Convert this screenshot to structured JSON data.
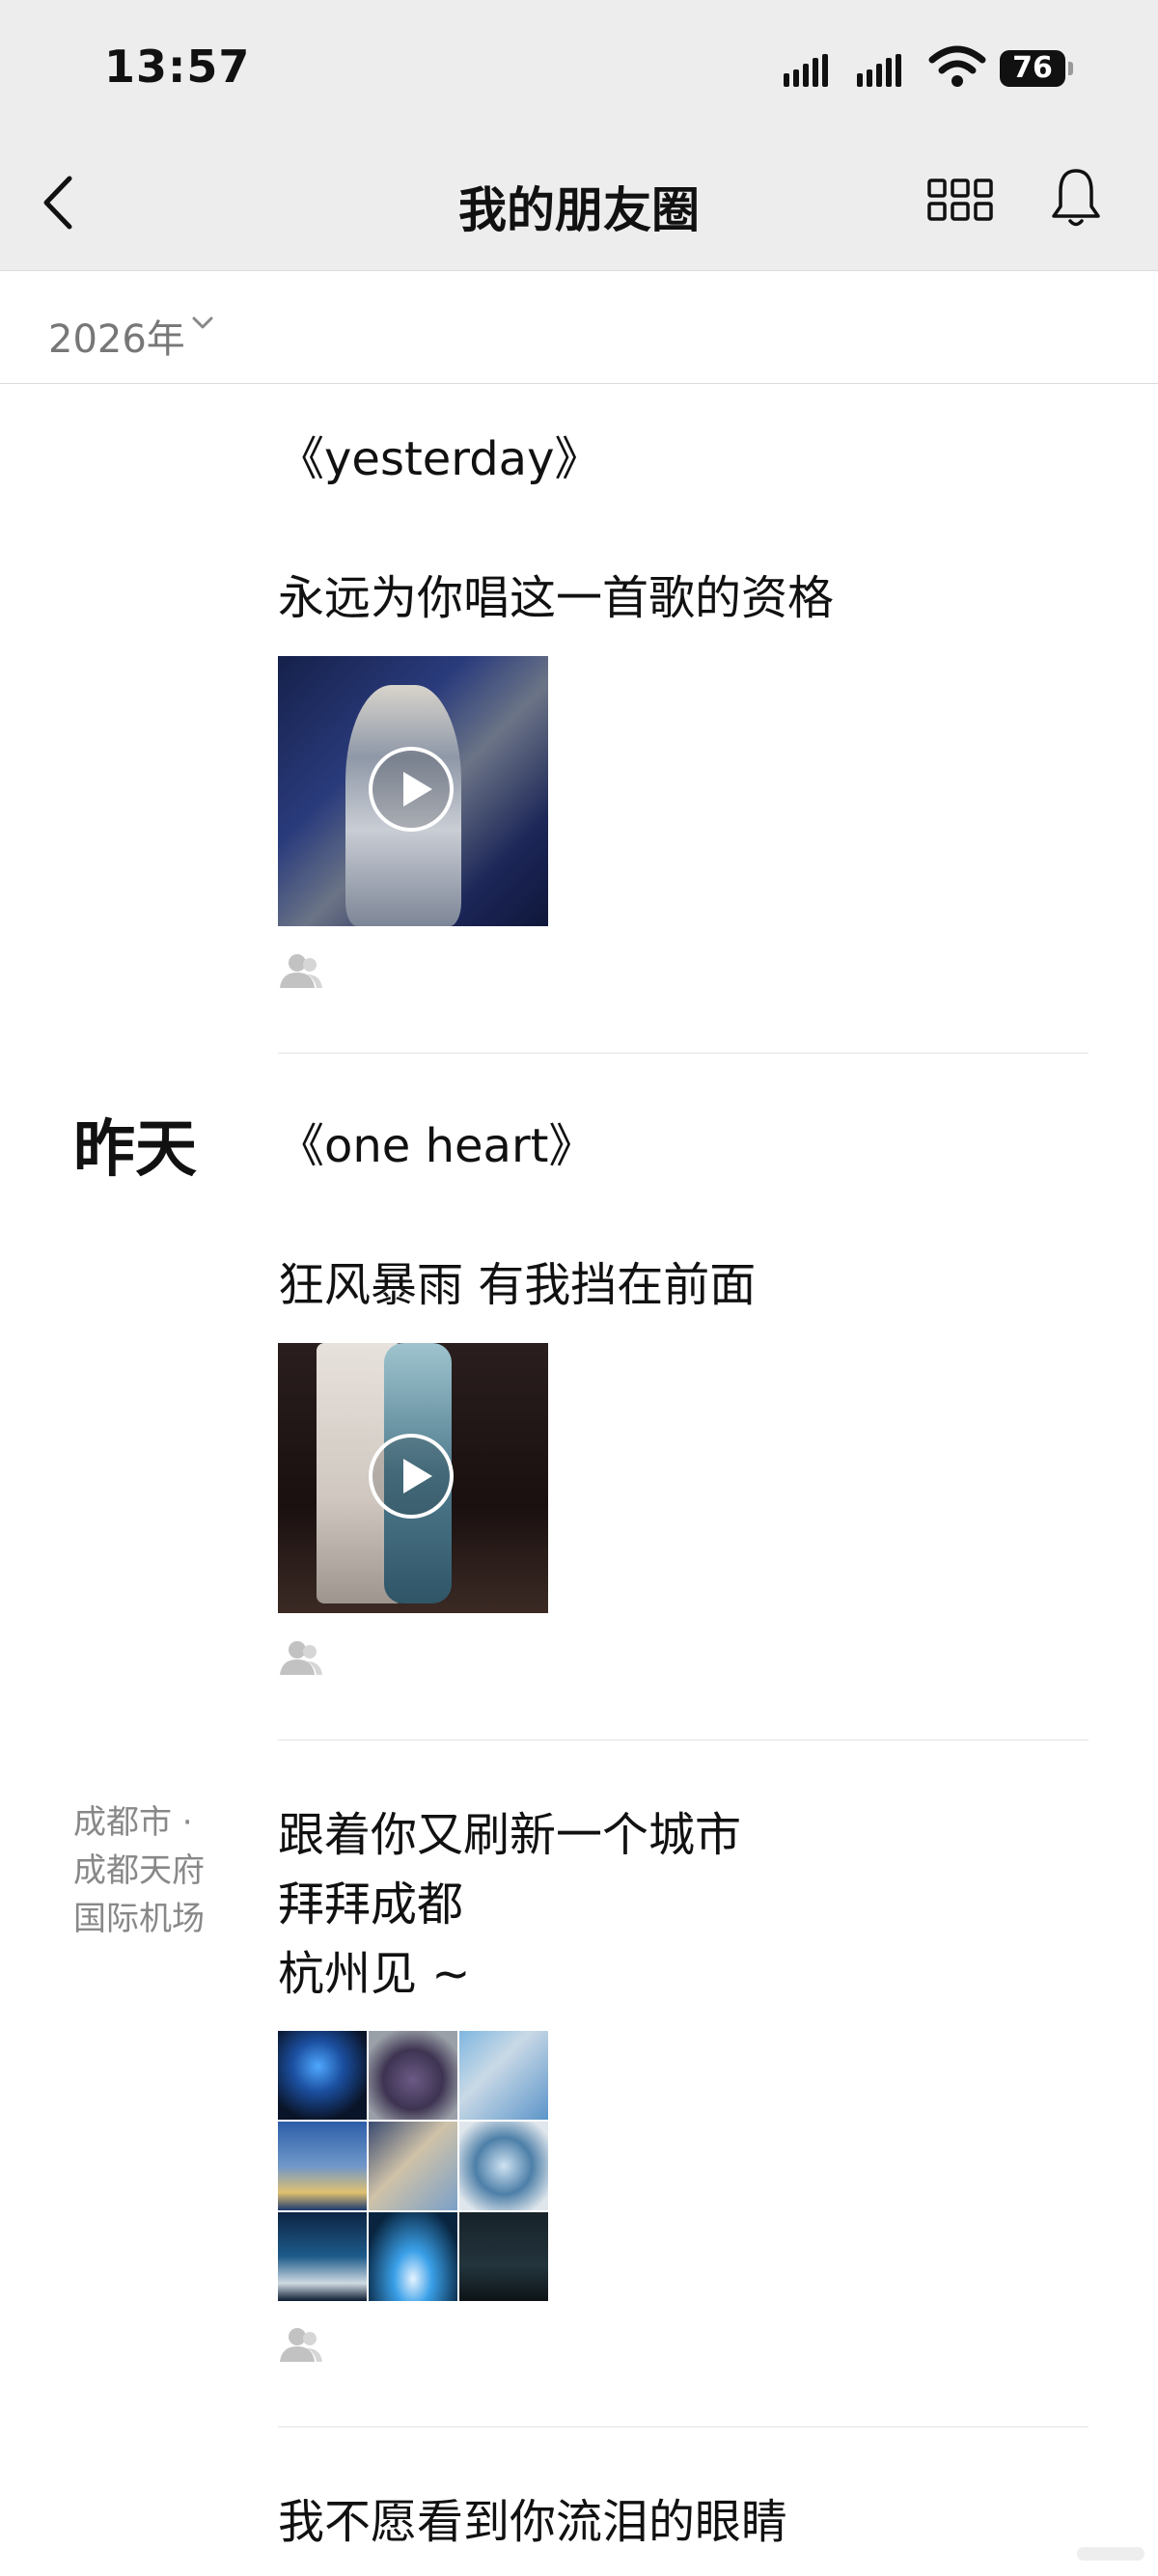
{
  "status_bar": {
    "time": "13:57",
    "battery": "76"
  },
  "header": {
    "title": "我的朋友圈"
  },
  "year_filter": {
    "label": "2026年"
  },
  "sections": {
    "yesterday_label": "昨天",
    "location_lines": [
      "成都市 ·",
      "成都天府",
      "国际机场"
    ]
  },
  "posts": [
    {
      "lines": [
        "《yesterday》",
        "",
        "永远为你唱这一首歌的资格"
      ]
    },
    {
      "lines": [
        "《one heart》",
        "",
        "狂风暴雨 有我挡在前面"
      ]
    },
    {
      "lines": [
        "跟着你又刷新一个城市",
        "拜拜成都",
        "杭州见 ~"
      ]
    },
    {
      "lines": [
        "我不愿看到你流泪的眼睛"
      ]
    }
  ],
  "colors": {
    "header_bg": "#ededed",
    "meta_gray": "#888888",
    "divider": "#e2e2e2"
  }
}
